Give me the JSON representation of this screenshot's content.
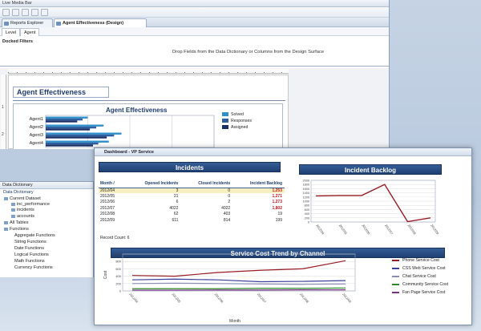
{
  "app": {
    "title": "Live Media Bar",
    "tabs": [
      {
        "label": "Reports Explorer"
      },
      {
        "label": "Agent Effectiveness (Design)"
      }
    ],
    "sub_tabs": [
      {
        "label": "Level"
      },
      {
        "label": "Agent"
      }
    ],
    "docked_filters_label": "Docked Filters",
    "drop_hint": "Drop Fields from the Data Dictionary or Columns from the Design Surface"
  },
  "design": {
    "report_title": "Agent Effectiveness",
    "chart_title": "Agent Effectiveness"
  },
  "data_dictionary": {
    "title": "Data Dictionary",
    "subtitle": "Data Dictionary",
    "items": [
      {
        "label": "Current Dataset"
      },
      {
        "label": "inc_performance"
      },
      {
        "label": "incidents"
      },
      {
        "label": "accounts"
      },
      {
        "label": "All Tables"
      },
      {
        "label": "Functions"
      },
      {
        "label": "Aggregate Functions"
      },
      {
        "label": "String Functions"
      },
      {
        "label": "Date Functions"
      },
      {
        "label": "Logical Functions"
      },
      {
        "label": "Math Functions"
      },
      {
        "label": "Currency Functions"
      }
    ]
  },
  "dashboard": {
    "title": "Dashboard - VP Service",
    "incidents_header": "Incidents",
    "columns": [
      "Month /",
      "Opened Incidents",
      "Closed Incidents",
      "Incident Backlog"
    ],
    "rows": [
      {
        "month": "2012/04",
        "opened": "3",
        "closed": "0",
        "backlog": "1,253"
      },
      {
        "month": "2012/05",
        "opened": "21",
        "closed": "0",
        "backlog": "1,271"
      },
      {
        "month": "2012/06",
        "opened": "6",
        "closed": "2",
        "backlog": "1,273"
      },
      {
        "month": "2012/07",
        "opened": "4022",
        "closed": "4022",
        "backlog": "1,802"
      },
      {
        "month": "2012/08",
        "opened": "62",
        "closed": "403",
        "backlog": "19"
      },
      {
        "month": "2012/09",
        "opened": "611",
        "closed": "814",
        "backlog": "199"
      }
    ],
    "record_count": "Record Count: 6",
    "backlog_header": "Incident Backlog",
    "trend_header": "Service Cost Trend by Channel"
  },
  "colors": {
    "bar_dark": "#1f3f72",
    "solved": "#2f8fc8",
    "responses": "#2f5f9e",
    "assigned": "#1a2f66",
    "phone": "#9a1b24",
    "css_web": "#3b3f9e",
    "chat": "#8a8db4",
    "community": "#2a8a2a",
    "fan_page": "#7a2f86"
  },
  "chart_data": [
    {
      "type": "bar",
      "title": "Agent Effectiveness",
      "orientation": "horizontal",
      "categories": [
        "Agent1",
        "Agent2",
        "Agent3",
        "Agent4"
      ],
      "series": [
        {
          "name": "Solved",
          "values": [
            40,
            55,
            72,
            60
          ]
        },
        {
          "name": "Responses",
          "values": [
            35,
            48,
            65,
            50
          ]
        },
        {
          "name": "Assigned",
          "values": [
            30,
            42,
            58,
            45
          ]
        }
      ],
      "xlim": [
        0,
        160
      ],
      "legend": "right"
    },
    {
      "type": "line",
      "title": "Incident Backlog",
      "x": [
        "2012/04",
        "2012/05",
        "2012/06",
        "2012/07",
        "2012/08",
        "2012/09"
      ],
      "series": [
        {
          "values": [
            1253,
            1271,
            1273,
            1802,
            19,
            199
          ]
        }
      ],
      "ylim": [
        0,
        2000
      ],
      "yticks": [
        0,
        200,
        400,
        600,
        800,
        1000,
        1200,
        1400,
        1600,
        1800,
        2000
      ],
      "grid": true
    },
    {
      "type": "line",
      "title": "Service Cost Trend by Channel",
      "xlabel": "Month",
      "ylabel": "Cost",
      "x": [
        "2012/04",
        "2012/05",
        "2012/06",
        "2012/07",
        "2012/08",
        "2012/09"
      ],
      "series": [
        {
          "name": "Phone Service Cost",
          "values": [
            420,
            400,
            500,
            560,
            600,
            820
          ]
        },
        {
          "name": "CSS Web Service Cost",
          "values": [
            300,
            320,
            300,
            250,
            260,
            280
          ]
        },
        {
          "name": "Chat Service Cost",
          "values": [
            200,
            210,
            200,
            190,
            180,
            190
          ]
        },
        {
          "name": "Community Service Cost",
          "values": [
            60,
            60,
            60,
            70,
            70,
            80
          ]
        },
        {
          "name": "Fan Page Service Cost",
          "values": [
            20,
            20,
            25,
            25,
            30,
            30
          ]
        }
      ],
      "ylim": [
        0,
        1000
      ],
      "yticks": [
        0,
        200,
        400,
        600,
        800,
        1000
      ],
      "legend": "right",
      "grid": true
    }
  ]
}
